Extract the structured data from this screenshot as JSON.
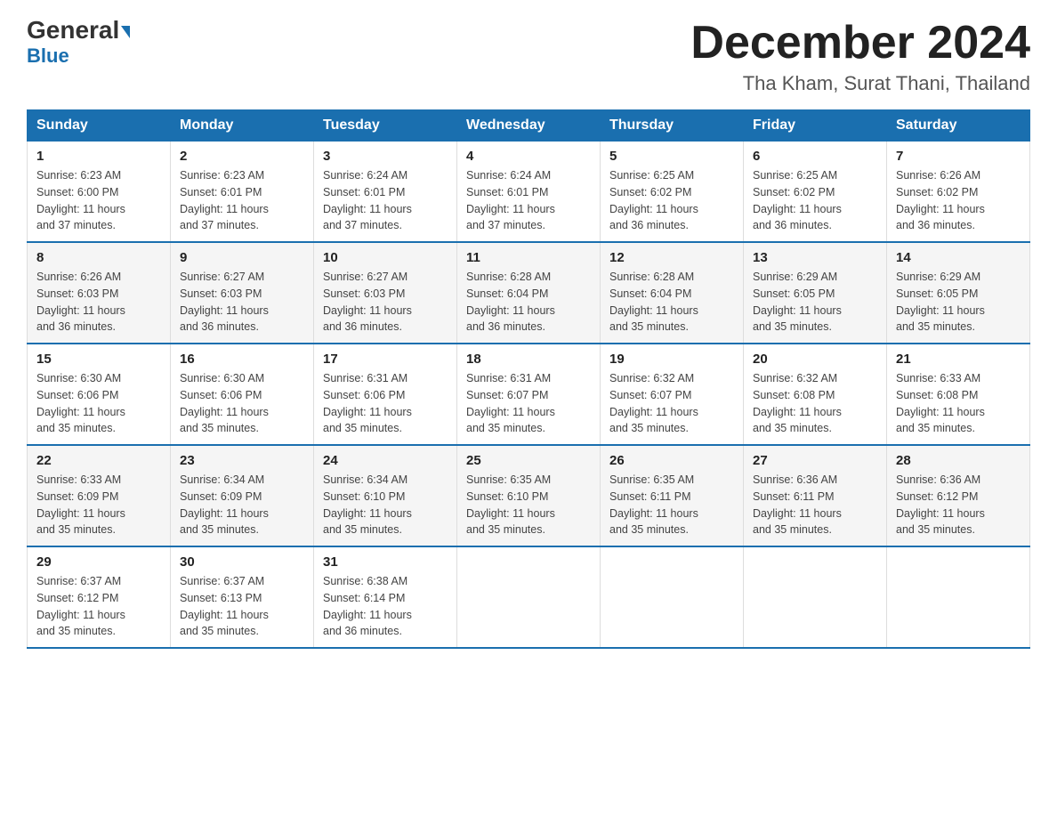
{
  "header": {
    "logo_general": "General",
    "logo_blue": "Blue",
    "month_title": "December 2024",
    "location": "Tha Kham, Surat Thani, Thailand"
  },
  "days_of_week": [
    "Sunday",
    "Monday",
    "Tuesday",
    "Wednesday",
    "Thursday",
    "Friday",
    "Saturday"
  ],
  "weeks": [
    [
      {
        "day": "1",
        "sunrise": "6:23 AM",
        "sunset": "6:00 PM",
        "daylight": "11 hours and 37 minutes."
      },
      {
        "day": "2",
        "sunrise": "6:23 AM",
        "sunset": "6:01 PM",
        "daylight": "11 hours and 37 minutes."
      },
      {
        "day": "3",
        "sunrise": "6:24 AM",
        "sunset": "6:01 PM",
        "daylight": "11 hours and 37 minutes."
      },
      {
        "day": "4",
        "sunrise": "6:24 AM",
        "sunset": "6:01 PM",
        "daylight": "11 hours and 37 minutes."
      },
      {
        "day": "5",
        "sunrise": "6:25 AM",
        "sunset": "6:02 PM",
        "daylight": "11 hours and 36 minutes."
      },
      {
        "day": "6",
        "sunrise": "6:25 AM",
        "sunset": "6:02 PM",
        "daylight": "11 hours and 36 minutes."
      },
      {
        "day": "7",
        "sunrise": "6:26 AM",
        "sunset": "6:02 PM",
        "daylight": "11 hours and 36 minutes."
      }
    ],
    [
      {
        "day": "8",
        "sunrise": "6:26 AM",
        "sunset": "6:03 PM",
        "daylight": "11 hours and 36 minutes."
      },
      {
        "day": "9",
        "sunrise": "6:27 AM",
        "sunset": "6:03 PM",
        "daylight": "11 hours and 36 minutes."
      },
      {
        "day": "10",
        "sunrise": "6:27 AM",
        "sunset": "6:03 PM",
        "daylight": "11 hours and 36 minutes."
      },
      {
        "day": "11",
        "sunrise": "6:28 AM",
        "sunset": "6:04 PM",
        "daylight": "11 hours and 36 minutes."
      },
      {
        "day": "12",
        "sunrise": "6:28 AM",
        "sunset": "6:04 PM",
        "daylight": "11 hours and 35 minutes."
      },
      {
        "day": "13",
        "sunrise": "6:29 AM",
        "sunset": "6:05 PM",
        "daylight": "11 hours and 35 minutes."
      },
      {
        "day": "14",
        "sunrise": "6:29 AM",
        "sunset": "6:05 PM",
        "daylight": "11 hours and 35 minutes."
      }
    ],
    [
      {
        "day": "15",
        "sunrise": "6:30 AM",
        "sunset": "6:06 PM",
        "daylight": "11 hours and 35 minutes."
      },
      {
        "day": "16",
        "sunrise": "6:30 AM",
        "sunset": "6:06 PM",
        "daylight": "11 hours and 35 minutes."
      },
      {
        "day": "17",
        "sunrise": "6:31 AM",
        "sunset": "6:06 PM",
        "daylight": "11 hours and 35 minutes."
      },
      {
        "day": "18",
        "sunrise": "6:31 AM",
        "sunset": "6:07 PM",
        "daylight": "11 hours and 35 minutes."
      },
      {
        "day": "19",
        "sunrise": "6:32 AM",
        "sunset": "6:07 PM",
        "daylight": "11 hours and 35 minutes."
      },
      {
        "day": "20",
        "sunrise": "6:32 AM",
        "sunset": "6:08 PM",
        "daylight": "11 hours and 35 minutes."
      },
      {
        "day": "21",
        "sunrise": "6:33 AM",
        "sunset": "6:08 PM",
        "daylight": "11 hours and 35 minutes."
      }
    ],
    [
      {
        "day": "22",
        "sunrise": "6:33 AM",
        "sunset": "6:09 PM",
        "daylight": "11 hours and 35 minutes."
      },
      {
        "day": "23",
        "sunrise": "6:34 AM",
        "sunset": "6:09 PM",
        "daylight": "11 hours and 35 minutes."
      },
      {
        "day": "24",
        "sunrise": "6:34 AM",
        "sunset": "6:10 PM",
        "daylight": "11 hours and 35 minutes."
      },
      {
        "day": "25",
        "sunrise": "6:35 AM",
        "sunset": "6:10 PM",
        "daylight": "11 hours and 35 minutes."
      },
      {
        "day": "26",
        "sunrise": "6:35 AM",
        "sunset": "6:11 PM",
        "daylight": "11 hours and 35 minutes."
      },
      {
        "day": "27",
        "sunrise": "6:36 AM",
        "sunset": "6:11 PM",
        "daylight": "11 hours and 35 minutes."
      },
      {
        "day": "28",
        "sunrise": "6:36 AM",
        "sunset": "6:12 PM",
        "daylight": "11 hours and 35 minutes."
      }
    ],
    [
      {
        "day": "29",
        "sunrise": "6:37 AM",
        "sunset": "6:12 PM",
        "daylight": "11 hours and 35 minutes."
      },
      {
        "day": "30",
        "sunrise": "6:37 AM",
        "sunset": "6:13 PM",
        "daylight": "11 hours and 35 minutes."
      },
      {
        "day": "31",
        "sunrise": "6:38 AM",
        "sunset": "6:14 PM",
        "daylight": "11 hours and 36 minutes."
      },
      null,
      null,
      null,
      null
    ]
  ],
  "labels": {
    "sunrise": "Sunrise:",
    "sunset": "Sunset:",
    "daylight": "Daylight:"
  }
}
